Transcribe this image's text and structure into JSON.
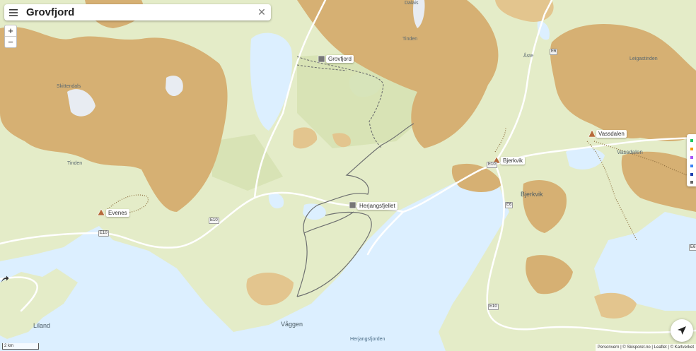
{
  "search": {
    "title": "Grovfjord",
    "menu_icon": "hamburger-icon",
    "clear_icon": "close-icon"
  },
  "zoom": {
    "in": "+",
    "out": "−"
  },
  "poi_labels": {
    "grovfjord": "Grovfjord",
    "herjangsfjellet": "Herjangsfjellet",
    "bjerkvik": "Bjerkvik",
    "vassdalen": "Vassdalen",
    "evenes": "Evenes"
  },
  "map_labels": {
    "dalais": "Dalais",
    "tinden_top": "Tinden",
    "skittendalas": "Skittendals",
    "tinden_left": "Tinden",
    "leigastinden": "Leigastinden",
    "vassdalen": "Vassdalen",
    "aste": "Åste"
  },
  "place_names": {
    "bjerkvik": "Bjerkvik",
    "liland": "Liland",
    "vaggen": "Våggen",
    "herjangsfjorden": "Herjangsfjorden"
  },
  "road_labels": {
    "e10_left": "E10",
    "e6_top": "E6",
    "e6_mid": "E6",
    "e10_mid": "E10",
    "e10_far": "E10",
    "e6_bottom": "E6",
    "e10_bottom": "E10"
  },
  "scale": "2 km",
  "attribution": {
    "p1": "Personvern",
    "sep1": " | © ",
    "p2": "Skisporet.no",
    "sep2": " | ",
    "p3": "Leaflet",
    "sep3": " | © ",
    "p4": "Kartverket"
  },
  "legend_colors": [
    "#22c55e",
    "#f59e0b",
    "#a855f7",
    "#3b82f6",
    "#1e40af",
    "#666666"
  ],
  "colors": {
    "water": "#dcefff",
    "lowland": "#e4ecc8",
    "forest": "#d6e2b2",
    "terrain": "#d6b073",
    "terrain_light": "#e3c58e",
    "road": "#ffffff",
    "trail": "#6e7070"
  },
  "icons": {
    "locate": "locate-arrow-icon",
    "share": "share-arrow-icon",
    "summit": "summit-triangle-icon",
    "lift": "lift-square-icon"
  }
}
